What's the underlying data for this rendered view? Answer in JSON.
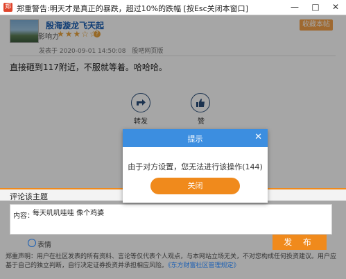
{
  "window": {
    "title": "郑重警告:明天才是真正的暴跌，超过10%的跌幅 [按Esc关闭本窗口]",
    "minimize": "—",
    "maximize": "□",
    "close": "✕"
  },
  "post": {
    "author": "殷海漩龙飞天起",
    "influence_label": "影响力",
    "stars": "★★★☆☆",
    "rating_stars": 3,
    "favorite": "收藏本帖",
    "time": "发表于 2020-09-01 14:50:08",
    "source": "股吧网页版",
    "body": "直接砸到117附近，不服就等着。哈哈哈。",
    "share_label": "转发",
    "like_label": "赞"
  },
  "comment": {
    "heading": "评论该主题",
    "prefix": "内容：",
    "text": "每天叽叽哇哇 像个鸡婆",
    "emoji_label": "表情",
    "publish": "发 布"
  },
  "notice": {
    "text": "郑重声明：用户在社区发表的所有资料、言论等仅代表个人观点，与本网站立场无关，不对您构成任何投资建议。用户应基于自己的独立判断，自行决定证券投资并承担相应风险。",
    "link": "《东方财富社区管理规定》"
  },
  "dialog": {
    "title": "提示",
    "close": "✕",
    "message": "由于对方设置，您无法进行该操作(144)",
    "ok": "关闭"
  },
  "colors": {
    "accent": "#f08a1c",
    "dialog_header": "#3c8ee0",
    "link": "#1a5fb4"
  }
}
